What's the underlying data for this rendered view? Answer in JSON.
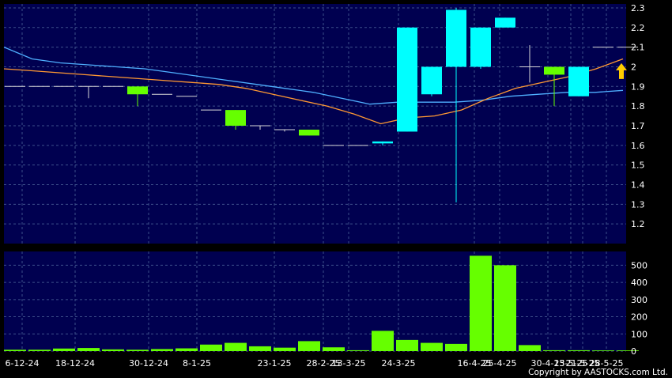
{
  "copyright": "Copyright by AASTOCKS.com Ltd.",
  "colors": {
    "plot_bg": "#000050",
    "page_bg": "#000000",
    "grid": "#3d4f8a",
    "up_candle": "#00ffff",
    "down_candle": "#66ff00",
    "flat_candle": "#d8d8d8",
    "volume_bar": "#66ff00",
    "ma_short": "#4fb0ff",
    "ma_long": "#ff9933",
    "arrow": "#ffcc00"
  },
  "chart_data": [
    {
      "type": "candlestick",
      "title": "",
      "ylim": [
        1.1,
        2.32
      ],
      "y_ticks": [
        "1.2",
        "1.3",
        "1.4",
        "1.5",
        "1.6",
        "1.7",
        "1.8",
        "1.9",
        "2",
        "2.1",
        "2.2",
        "2.3"
      ],
      "x_ticks": [
        "6-12-24",
        "18-12-24",
        "30-12-24",
        "8-1-25",
        "23-1-25",
        "28-2-25",
        "13-3-25",
        "24-3-25",
        "16-4-25",
        "25-4-25",
        "30-4-25",
        "13-5-25",
        "21-5-25",
        "28-5-25"
      ],
      "candles": [
        {
          "o": 1.9,
          "h": 1.9,
          "l": 1.9,
          "c": 1.9
        },
        {
          "o": 1.9,
          "h": 1.9,
          "l": 1.9,
          "c": 1.9
        },
        {
          "o": 1.9,
          "h": 1.9,
          "l": 1.9,
          "c": 1.9
        },
        {
          "o": 1.9,
          "h": 1.9,
          "l": 1.84,
          "c": 1.9
        },
        {
          "o": 1.9,
          "h": 1.9,
          "l": 1.9,
          "c": 1.9
        },
        {
          "o": 1.9,
          "h": 1.9,
          "l": 1.8,
          "c": 1.86
        },
        {
          "o": 1.86,
          "h": 1.86,
          "l": 1.86,
          "c": 1.86
        },
        {
          "o": 1.85,
          "h": 1.85,
          "l": 1.85,
          "c": 1.85
        },
        {
          "o": 1.78,
          "h": 1.78,
          "l": 1.78,
          "c": 1.78
        },
        {
          "o": 1.78,
          "h": 1.78,
          "l": 1.68,
          "c": 1.7
        },
        {
          "o": 1.7,
          "h": 1.7,
          "l": 1.68,
          "c": 1.7
        },
        {
          "o": 1.68,
          "h": 1.68,
          "l": 1.67,
          "c": 1.68
        },
        {
          "o": 1.68,
          "h": 1.68,
          "l": 1.65,
          "c": 1.65
        },
        {
          "o": 1.6,
          "h": 1.6,
          "l": 1.6,
          "c": 1.6
        },
        {
          "o": 1.6,
          "h": 1.6,
          "l": 1.6,
          "c": 1.6
        },
        {
          "o": 1.61,
          "h": 1.62,
          "l": 1.6,
          "c": 1.62
        },
        {
          "o": 1.67,
          "h": 2.2,
          "l": 1.67,
          "c": 2.2
        },
        {
          "o": 1.86,
          "h": 2.0,
          "l": 1.85,
          "c": 2.0
        },
        {
          "o": 2.0,
          "h": 2.3,
          "l": 1.31,
          "c": 2.29
        },
        {
          "o": 2.0,
          "h": 2.2,
          "l": 1.99,
          "c": 2.2
        },
        {
          "o": 2.2,
          "h": 2.25,
          "l": 2.2,
          "c": 2.25
        },
        {
          "o": 2.0,
          "h": 2.11,
          "l": 1.92,
          "c": 2.0
        },
        {
          "o": 2.0,
          "h": 2.0,
          "l": 1.8,
          "c": 1.96
        },
        {
          "o": 1.85,
          "h": 2.0,
          "l": 1.85,
          "c": 2.0
        },
        {
          "o": 2.1,
          "h": 2.1,
          "l": 2.1,
          "c": 2.1
        },
        {
          "o": 2.1,
          "h": 2.1,
          "l": 2.1,
          "c": 2.1
        }
      ],
      "series": [
        {
          "values": [
            2.1,
            2.04,
            2.02,
            2.01,
            2.0,
            1.99,
            1.97,
            1.95,
            1.93,
            1.91,
            1.89,
            1.87,
            1.84,
            1.81,
            1.82,
            1.82,
            1.82,
            1.83,
            1.85,
            1.86,
            1.87,
            1.87,
            1.88
          ]
        },
        {
          "values": [
            1.99,
            1.98,
            1.97,
            1.96,
            1.95,
            1.94,
            1.93,
            1.92,
            1.91,
            1.89,
            1.86,
            1.83,
            1.8,
            1.76,
            1.71,
            1.74,
            1.75,
            1.78,
            1.84,
            1.89,
            1.92,
            1.95,
            1.99,
            2.04
          ]
        }
      ],
      "signal_arrow": {
        "candle_index": 25,
        "direction": "up"
      }
    },
    {
      "type": "bar",
      "ylim": [
        0,
        580
      ],
      "y_ticks": [
        "0",
        "100",
        "200",
        "300",
        "400",
        "500"
      ],
      "values": [
        8,
        8,
        15,
        18,
        10,
        8,
        12,
        16,
        38,
        48,
        28,
        20,
        58,
        22,
        5,
        118,
        65,
        48,
        42,
        555,
        500,
        35,
        5,
        5,
        4,
        4
      ]
    }
  ]
}
